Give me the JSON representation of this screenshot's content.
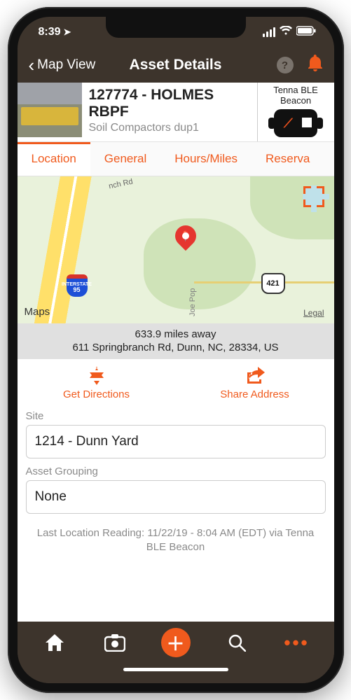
{
  "status": {
    "time": "8:39",
    "loc_icon": "➤"
  },
  "nav": {
    "back_label": "Map View",
    "title": "Asset Details"
  },
  "asset": {
    "title": "127774 - HOLMES RBPF",
    "subtitle": "Soil Compactors dup1",
    "beacon_label": "Tenna BLE Beacon"
  },
  "tabs": [
    "Location",
    "General",
    "Hours/Miles",
    "Reserva"
  ],
  "map": {
    "road_label": "nch Rd",
    "i95": "95",
    "us421": "421",
    "provider": "Maps",
    "legal": "Legal",
    "street2": "Joe Pop"
  },
  "location": {
    "distance": "633.9 miles away",
    "address": "611 Springbranch Rd, Dunn, NC, 28334, US"
  },
  "actions": {
    "directions": "Get Directions",
    "share": "Share Address"
  },
  "fields": {
    "site_label": "Site",
    "site_value": "1214 - Dunn Yard",
    "group_label": "Asset Grouping",
    "group_value": "None"
  },
  "last_reading": "Last Location Reading: 11/22/19 - 8:04 AM  (EDT) via Tenna BLE Beacon",
  "colors": {
    "accent": "#f05a1d"
  }
}
